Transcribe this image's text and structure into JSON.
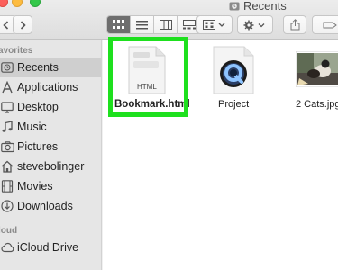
{
  "window": {
    "title": "Recents"
  },
  "sidebar": {
    "favorites_header": "avorites",
    "cloud_header": "loud",
    "items": [
      {
        "label": "Recents",
        "icon": "clock-icon",
        "selected": true
      },
      {
        "label": "Applications",
        "icon": "applications-icon"
      },
      {
        "label": "Desktop",
        "icon": "desktop-icon"
      },
      {
        "label": "Music",
        "icon": "music-note-icon"
      },
      {
        "label": "Pictures",
        "icon": "camera-icon"
      },
      {
        "label": "stevebolinger",
        "icon": "home-icon"
      },
      {
        "label": "Movies",
        "icon": "film-icon"
      },
      {
        "label": "Downloads",
        "icon": "download-icon"
      }
    ],
    "cloud_items": [
      {
        "label": "iCloud Drive",
        "icon": "cloud-icon"
      }
    ]
  },
  "files": [
    {
      "name": "Bookmark.html",
      "type_label": "HTML",
      "icon": "html-document-icon",
      "selected": true
    },
    {
      "name": "Project",
      "icon": "quicktime-icon"
    },
    {
      "name": "2 Cats.jpg",
      "icon": "image-thumbnail-icon"
    }
  ],
  "colors": {
    "highlight": "#1ee01e",
    "sidebar_bg": "#e6e6e6",
    "selected_bg": "#cfcfcf",
    "content_bg": "#ffffff"
  }
}
